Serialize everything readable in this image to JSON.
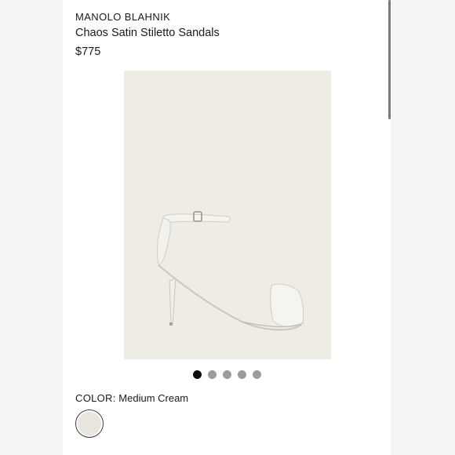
{
  "product": {
    "brand": "MANOLO BLAHNIK",
    "name": "Chaos Satin Stiletto Sandals",
    "price": "$775"
  },
  "gallery": {
    "image_count": 5,
    "active_index": 0
  },
  "color": {
    "label": "COLOR:",
    "value": "Medium Cream",
    "swatch_hex": "#e9e5dc"
  },
  "theme": {
    "image_background": "#efece6",
    "dot_active": "#0c0c0c",
    "dot_inactive": "#9c9c9c"
  }
}
